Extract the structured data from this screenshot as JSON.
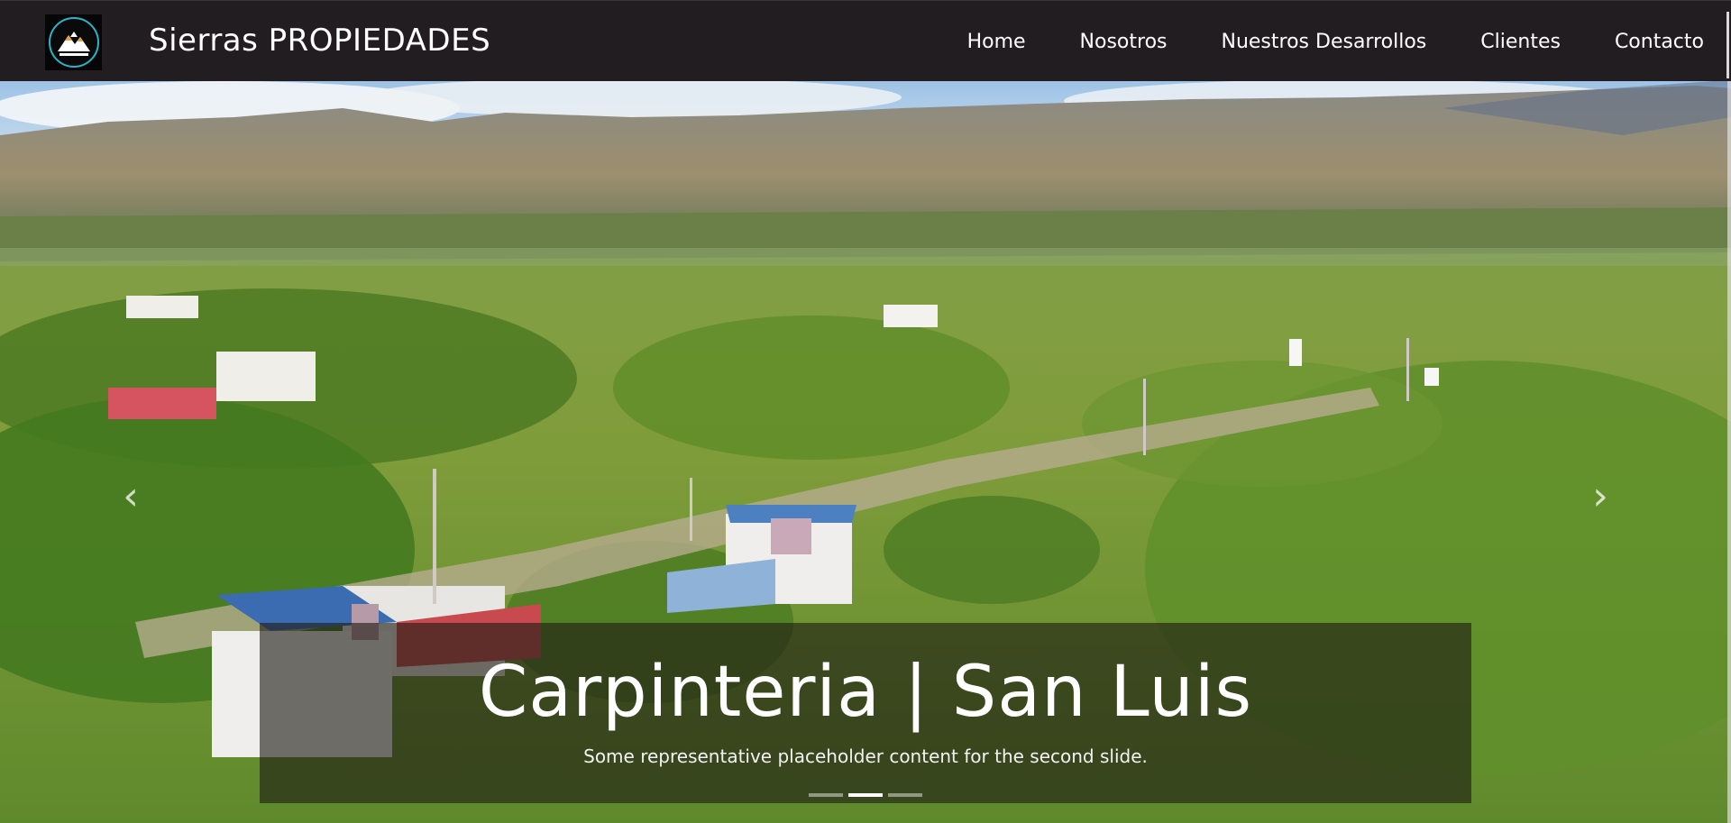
{
  "site": {
    "brand": "Sierras PROPIEDADES",
    "logo_text": "Sierras PROPIEDADES"
  },
  "nav": {
    "items": [
      {
        "label": "Home"
      },
      {
        "label": "Nosotros"
      },
      {
        "label": "Nuestros Desarrollos"
      },
      {
        "label": "Clientes"
      },
      {
        "label": "Contacto"
      }
    ]
  },
  "carousel": {
    "slide": {
      "title": "Carpinteria | San Luis",
      "text": "Some representative placeholder content for the second slide."
    },
    "prev_icon": "chevron-left",
    "next_icon": "chevron-right",
    "indicators": [
      {
        "active": false
      },
      {
        "active": true
      },
      {
        "active": false
      }
    ]
  },
  "colors": {
    "navbar": "#221d21",
    "logo_ring": "#2bb3c6",
    "caption_overlay": "rgba(30,28,20,0.62)"
  }
}
